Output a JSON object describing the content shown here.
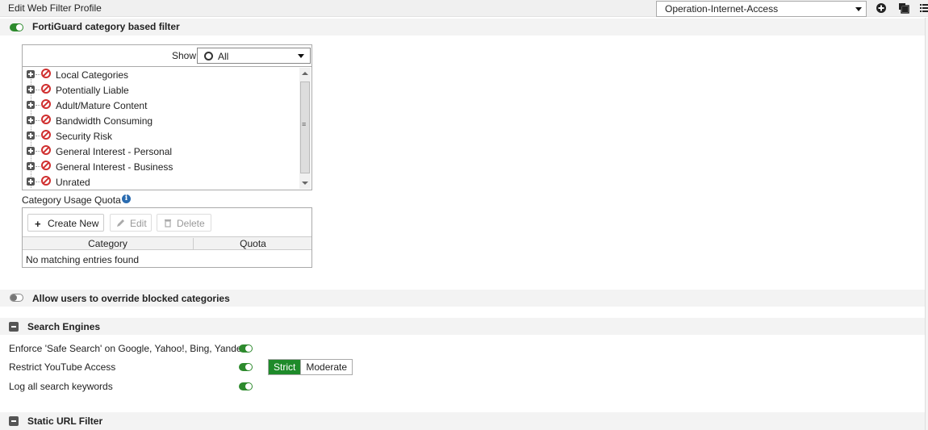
{
  "header": {
    "title": "Edit Web Filter Profile",
    "profile_value": "Operation-Internet-Access"
  },
  "fortiguard": {
    "label": "FortiGuard category based filter",
    "enabled": true,
    "show_label": "Show",
    "show_value": "All",
    "categories": [
      "Local Categories",
      "Potentially Liable",
      "Adult/Mature Content",
      "Bandwidth Consuming",
      "Security Risk",
      "General Interest - Personal",
      "General Interest - Business",
      "Unrated"
    ]
  },
  "quota": {
    "title": "Category Usage Quota",
    "create_new": "Create New",
    "edit": "Edit",
    "delete": "Delete",
    "col_category": "Category",
    "col_quota": "Quota",
    "empty_text": "No matching entries found"
  },
  "override": {
    "label": "Allow users to override blocked categories",
    "enabled": false
  },
  "search_engines": {
    "title": "Search Engines",
    "safe_search_label": "Enforce 'Safe Search' on Google, Yahoo!, Bing, Yandex",
    "youtube_label": "Restrict YouTube Access",
    "log_keywords_label": "Log all search keywords",
    "strict_label": "Strict",
    "moderate_label": "Moderate"
  },
  "static_url": {
    "title": "Static URL Filter"
  },
  "colors": {
    "toggle_on": "#2d8a2d",
    "active_segment": "#1e8a2a",
    "block_icon": "#d03030"
  }
}
